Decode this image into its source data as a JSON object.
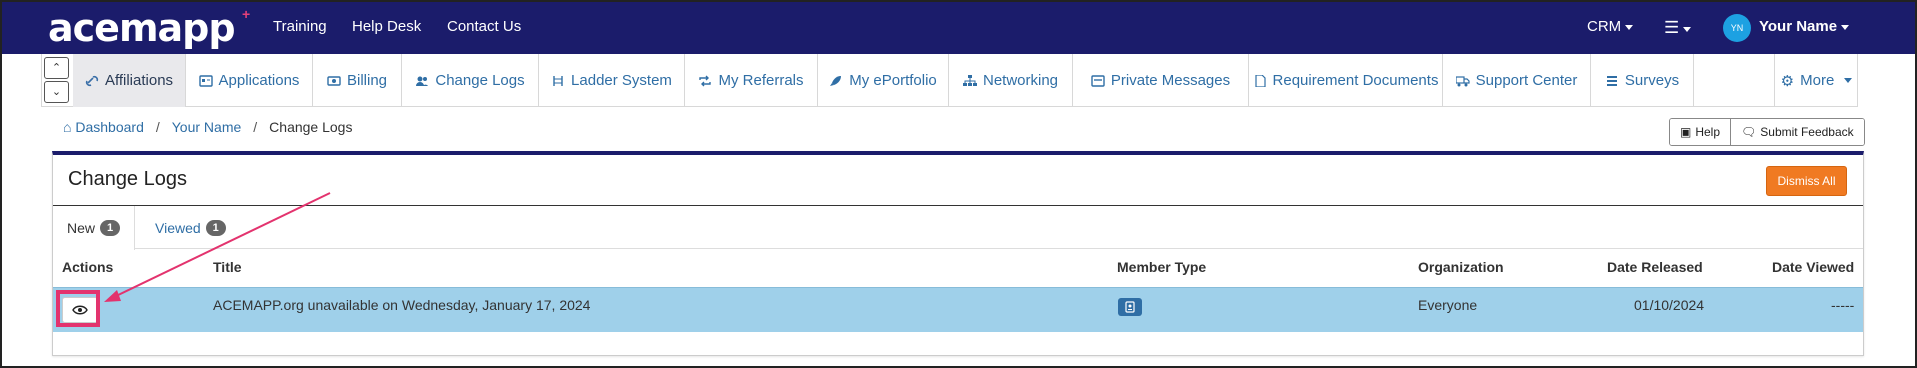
{
  "brand": {
    "logo_text": "acemapp",
    "logo_mark": "+"
  },
  "topnav": {
    "links": [
      "Training",
      "Help Desk",
      "Contact Us"
    ],
    "crm_label": "CRM",
    "user_initials": "YN",
    "user_name": "Your Name"
  },
  "modules": [
    {
      "label": "Affiliations",
      "icon": "link-icon"
    },
    {
      "label": "Applications",
      "icon": "id-card-icon"
    },
    {
      "label": "Billing",
      "icon": "money-icon"
    },
    {
      "label": "Change Logs",
      "icon": "users-icon"
    },
    {
      "label": "Ladder System",
      "icon": "ladder-icon"
    },
    {
      "label": "My Referrals",
      "icon": "retweet-icon"
    },
    {
      "label": "My ePortfolio",
      "icon": "rocket-icon"
    },
    {
      "label": "Networking",
      "icon": "sitemap-icon"
    },
    {
      "label": "Private Messages",
      "icon": "message-icon"
    },
    {
      "label": "Requirement Documents",
      "icon": "document-icon"
    },
    {
      "label": "Support Center",
      "icon": "truck-icon"
    },
    {
      "label": "Surveys",
      "icon": "list-icon"
    },
    {
      "label": "More",
      "icon": "gear-icon"
    }
  ],
  "breadcrumb": {
    "items": [
      "Dashboard",
      "Your Name",
      "Change Logs"
    ]
  },
  "actions": {
    "help": "Help",
    "feedback": "Submit Feedback"
  },
  "panel": {
    "title": "Change Logs",
    "dismiss_all": "Dismiss All",
    "tabs": [
      {
        "label": "New",
        "count": "1"
      },
      {
        "label": "Viewed",
        "count": "1"
      }
    ]
  },
  "table": {
    "headers": [
      "Actions",
      "Title",
      "Member Type",
      "Organization",
      "Date Released",
      "Date Viewed"
    ],
    "rows": [
      {
        "title": "ACEMAPP.org unavailable on Wednesday, January 17, 2024",
        "member_type_icon": "id-badge-icon",
        "organization": "Everyone",
        "date_released": "01/10/2024",
        "date_viewed": "-----"
      }
    ]
  },
  "colors": {
    "navbar": "#1b1c6b",
    "accent_pink": "#e3336e",
    "dismiss_orange": "#f07a22",
    "row_highlight": "#9fd0ea",
    "link_blue": "#2f6ea5"
  }
}
